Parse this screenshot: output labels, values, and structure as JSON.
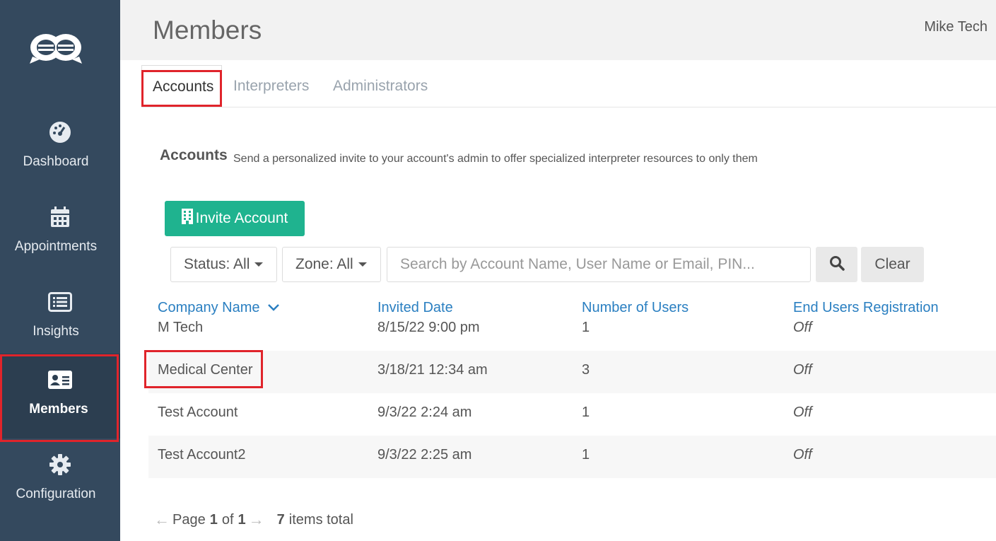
{
  "sidebar": {
    "items": [
      {
        "label": "Dashboard",
        "icon": "dashboard-gauge-icon"
      },
      {
        "label": "Appointments",
        "icon": "calendar-icon"
      },
      {
        "label": "Insights",
        "icon": "list-alt-icon"
      },
      {
        "label": "Members",
        "icon": "id-card-icon",
        "active": true
      },
      {
        "label": "Configuration",
        "icon": "gear-icon"
      }
    ]
  },
  "header": {
    "title": "Members",
    "user": "Mike Tech"
  },
  "tabs": [
    {
      "label": "Accounts",
      "active": true
    },
    {
      "label": "Interpreters"
    },
    {
      "label": "Administrators"
    }
  ],
  "section": {
    "title": "Accounts",
    "description": "Send a personalized invite to your account's admin to offer specialized interpreter resources to only them"
  },
  "toolbar": {
    "invite_label": "Invite Account",
    "status_filter": "Status: All",
    "zone_filter": "Zone: All",
    "search_placeholder": "Search by Account Name, User Name or Email, PIN...",
    "clear_label": "Clear"
  },
  "table": {
    "headers": {
      "company": "Company Name",
      "invited": "Invited Date",
      "users": "Number of Users",
      "registration": "End Users Registration"
    },
    "rows": [
      {
        "company": "M Tech",
        "invited": "8/15/22 9:00 pm",
        "users": "1",
        "registration": "Off"
      },
      {
        "company": "Medical Center",
        "invited": "3/18/21 12:34 am",
        "users": "3",
        "registration": "Off"
      },
      {
        "company": "Test Account",
        "invited": "9/3/22 2:24 am",
        "users": "1",
        "registration": "Off"
      },
      {
        "company": "Test Account2",
        "invited": "9/3/22 2:25 am",
        "users": "1",
        "registration": "Off"
      }
    ]
  },
  "pagination": {
    "page_word": "Page",
    "current": "1",
    "of_word": "of",
    "total_pages": "1",
    "items_total": "7",
    "items_label": "items total"
  },
  "colors": {
    "sidebar_bg": "#34495e",
    "accent_green": "#1fb38f",
    "link_blue": "#2a7fc1",
    "highlight_red": "#e0242b"
  }
}
